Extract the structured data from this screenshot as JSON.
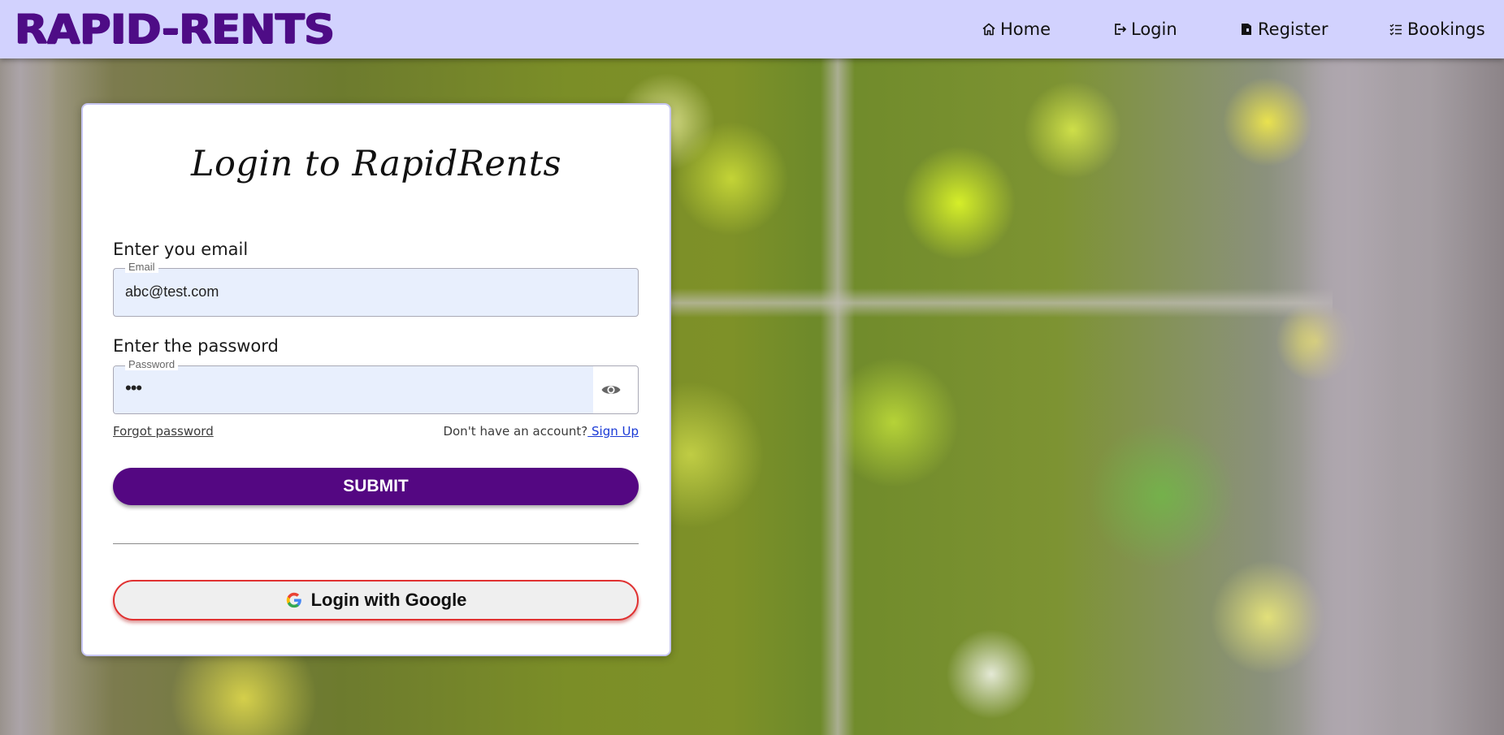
{
  "header": {
    "brand": "RAPID-RENTS",
    "nav": [
      {
        "label": "Home",
        "icon": "home-icon"
      },
      {
        "label": "Login",
        "icon": "login-icon"
      },
      {
        "label": "Register",
        "icon": "register-icon"
      },
      {
        "label": "Bookings",
        "icon": "bookings-list-icon"
      }
    ]
  },
  "login_card": {
    "title": "Login to RapidRents",
    "email": {
      "label": "Enter you email",
      "legend": "Email",
      "value": "abc@test.com"
    },
    "password": {
      "label": "Enter the password",
      "legend": "Password",
      "masked_value": "•••",
      "toggle_icon": "eye-icon"
    },
    "forgot_password": "Forgot password",
    "no_account_text": "Don't have an account?",
    "sign_up": " Sign Up",
    "submit": "SUBMIT",
    "google_login": "Login with Google"
  },
  "colors": {
    "navbar_bg": "#d2d2fe",
    "brand": "#4e0c86",
    "submit_bg": "#540782",
    "google_border": "#e03131",
    "input_bg": "#e8effd",
    "link": "#1a3ad6"
  }
}
